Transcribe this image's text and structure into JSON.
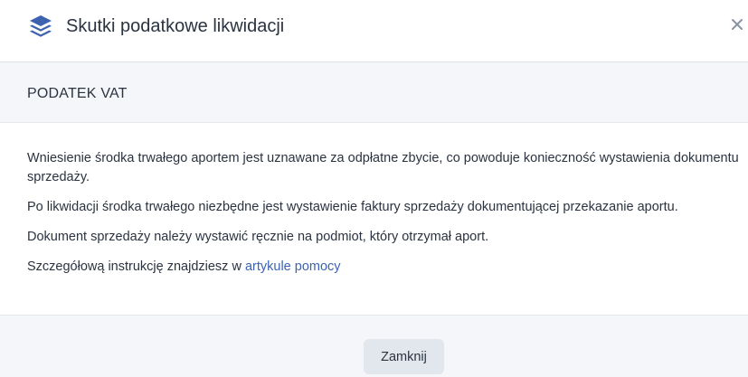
{
  "dialog": {
    "title": "Skutki podatkowe likwidacji",
    "icon": "layers-icon",
    "close_icon": "close-icon",
    "accent_color": "#3d63b0"
  },
  "section": {
    "title": "PODATEK VAT"
  },
  "body": {
    "paragraph_1": "Wniesienie środka trwałego aportem jest uznawane za odpłatne zbycie, co powoduje konieczność wystawienia dokumentu sprzedaży.",
    "paragraph_2": "Po likwidacji środka trwałego niezbędne jest wystawienie faktury sprzedaży dokumentującej przekazanie aportu.",
    "paragraph_3": "Dokument sprzedaży należy wystawić ręcznie na podmiot, który otrzymał aport.",
    "paragraph_4_prefix": "Szczegółową instrukcję znajdziesz w ",
    "help_link_label": "artykule pomocy"
  },
  "footer": {
    "close_button_label": "Zamknij"
  }
}
